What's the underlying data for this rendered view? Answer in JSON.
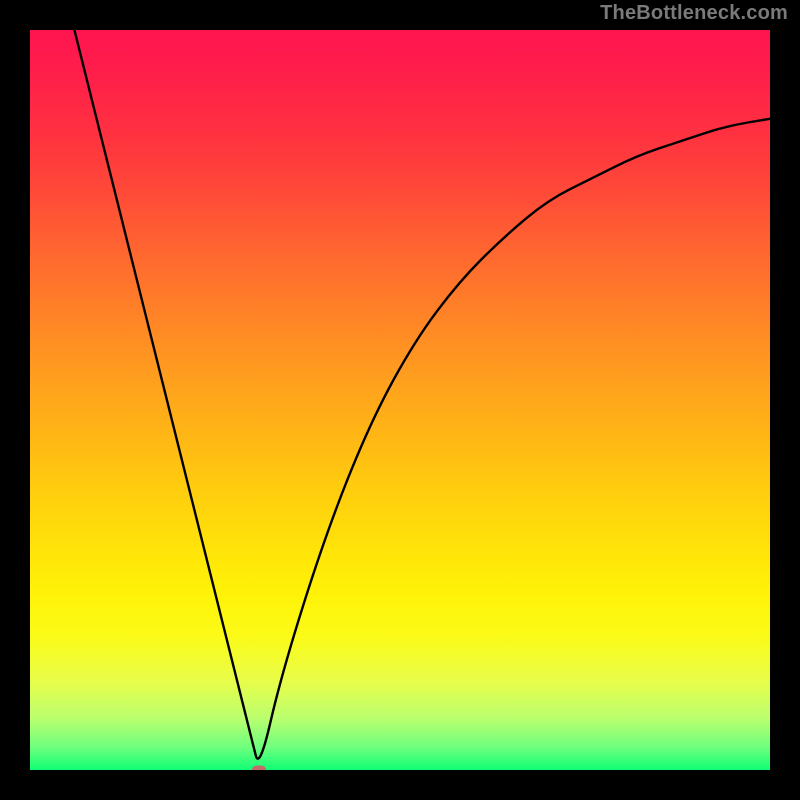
{
  "watermark": "TheBottleneck.com",
  "colors": {
    "frame": "#000000",
    "curve": "#000000",
    "marker": "#c36a6a"
  },
  "chart_data": {
    "type": "line",
    "title": "",
    "xlabel": "",
    "ylabel": "",
    "xlim": [
      0,
      100
    ],
    "ylim": [
      0,
      100
    ],
    "grid": false,
    "legend": false,
    "background_gradient": {
      "top": "red",
      "bottom": "green",
      "meaning": "bottleneck severity (red high, green low)"
    },
    "series": [
      {
        "name": "bottleneck-curve",
        "x": [
          6,
          10,
          14,
          18,
          22,
          26,
          28,
          30,
          31,
          34,
          40,
          46,
          52,
          58,
          64,
          70,
          76,
          82,
          88,
          94,
          100
        ],
        "y": [
          100,
          84,
          68,
          52,
          36,
          20,
          12,
          4,
          0,
          13,
          32,
          47,
          58,
          66,
          72,
          77,
          80,
          83,
          85,
          87,
          88
        ]
      }
    ],
    "marker": {
      "x": 31,
      "y": 0,
      "label": ""
    }
  }
}
